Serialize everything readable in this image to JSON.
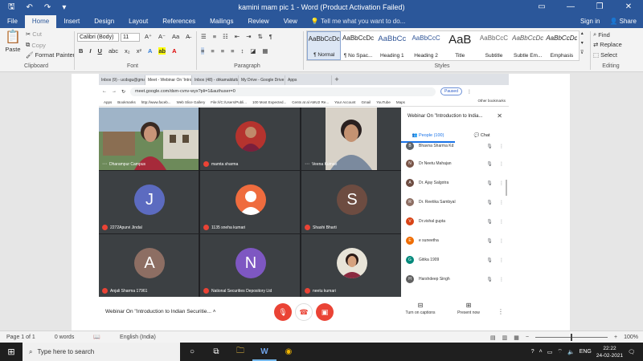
{
  "window": {
    "title": "kamini mam pic 1 - Word (Product Activation Failed)",
    "controls": [
      "▭",
      "—",
      "❐",
      "✕"
    ]
  },
  "ribbon_tabs": [
    "File",
    "Home",
    "Insert",
    "Design",
    "Layout",
    "References",
    "Mailings",
    "Review",
    "View"
  ],
  "active_tab": "Home",
  "tell_me": "Tell me what you want to do...",
  "sign_in": "Sign in",
  "share": "Share",
  "clipboard": {
    "paste": "Paste",
    "cut": "Cut",
    "copy": "Copy",
    "format_painter": "Format Painter",
    "label": "Clipboard"
  },
  "font": {
    "name": "Calibri (Body)",
    "size": "11",
    "label": "Font"
  },
  "paragraph": {
    "label": "Paragraph"
  },
  "styles": {
    "label": "Styles",
    "items": [
      {
        "sample": "AaBbCcDc",
        "name": "¶ Normal"
      },
      {
        "sample": "AaBbCcDc",
        "name": "¶ No Spac..."
      },
      {
        "sample": "AaBbCc",
        "name": "Heading 1"
      },
      {
        "sample": "AaBbCcC",
        "name": "Heading 2"
      },
      {
        "sample": "AaB",
        "name": "Title"
      },
      {
        "sample": "AaBbCcC",
        "name": "Subtitle"
      },
      {
        "sample": "AaBbCcDc",
        "name": "Subtle Em..."
      },
      {
        "sample": "AaBbCcDc",
        "name": "Emphasis"
      }
    ]
  },
  "editing": {
    "find": "Find",
    "replace": "Replace",
    "select": "Select",
    "label": "Editing"
  },
  "browser": {
    "tabs": [
      "Inbox (9) - ucdsgu@gmail.com",
      "Meet - Webinar On 'Introdu...'",
      "Inbox (48) - drkamaldutta@g...",
      "My Drive - Google Drive",
      "Apps"
    ],
    "url": "meet.google.com/dsm-cvnv-wyx?pli=1&authuser=0",
    "paused": "Paused",
    "bookmarks": [
      "Apps",
      "Bookmarks",
      "http://www.faceb...",
      "Web Slice Gallery",
      "File:///C:/Users/Publi...",
      "100 Most Expected...",
      "Cents at al AMU2 Re...",
      "Your Account",
      "Gmail",
      "YouTube",
      "Maps"
    ],
    "other_bookmarks": "Other bookmarks"
  },
  "meet": {
    "tiles": [
      {
        "name": "Dharampur Campus",
        "type": "photo"
      },
      {
        "name": "mamta sharma",
        "type": "photo-avatar"
      },
      {
        "name": "Veena Kumari",
        "type": "photo"
      },
      {
        "name": "2272Apurvi Jindal",
        "type": "letter",
        "letter": "J",
        "color": "#5c6bc0"
      },
      {
        "name": "1135 sneha kumari",
        "type": "person-icon",
        "color": "#ef6c3e"
      },
      {
        "name": "Shashi Bharti",
        "type": "letter",
        "letter": "S",
        "color": "#6d4c41"
      },
      {
        "name": "Anjali Sharma 17961",
        "type": "letter",
        "letter": "A",
        "color": "#8d6e63"
      },
      {
        "name": "National Securities Depository Ltd",
        "type": "letter",
        "letter": "N",
        "color": "#7e57c2"
      },
      {
        "name": "neetu kumari",
        "type": "photo-avatar"
      }
    ],
    "panel": {
      "title": "Webinar On \"Introduction to India...",
      "people_tab": "People (100)",
      "chat_tab": "Chat",
      "people": [
        {
          "name": "Bhavna Sharma Kd",
          "initial": "B",
          "color": "#5f6368"
        },
        {
          "name": "Dr Neetu Mahajan",
          "initial": "N",
          "color": "#795548"
        },
        {
          "name": "Dr. Ajay Salgotra",
          "initial": "A",
          "color": "#6d4c41"
        },
        {
          "name": "Dr. Reetika Sambyal",
          "initial": "R",
          "color": "#8d6e63"
        },
        {
          "name": "Dr.vishal gupta",
          "initial": "V",
          "color": "#d84315"
        },
        {
          "name": "e suneetha",
          "initial": "E",
          "color": "#ef6c00"
        },
        {
          "name": "Gitika 1909",
          "initial": "G",
          "color": "#00897b"
        },
        {
          "name": "Harshdeep Singh",
          "initial": "H",
          "color": "#616161"
        }
      ]
    },
    "meeting_title": "Webinar On \"Introduction to Indian Securitie...",
    "captions": "Turn on captions",
    "present": "Present now"
  },
  "status": {
    "page": "Page 1 of 1",
    "words": "0 words",
    "language": "English (India)",
    "zoom": "100%"
  },
  "taskbar": {
    "search_placeholder": "Type here to search",
    "language": "ENG",
    "time": "22:22",
    "date": "24-02-2021"
  }
}
